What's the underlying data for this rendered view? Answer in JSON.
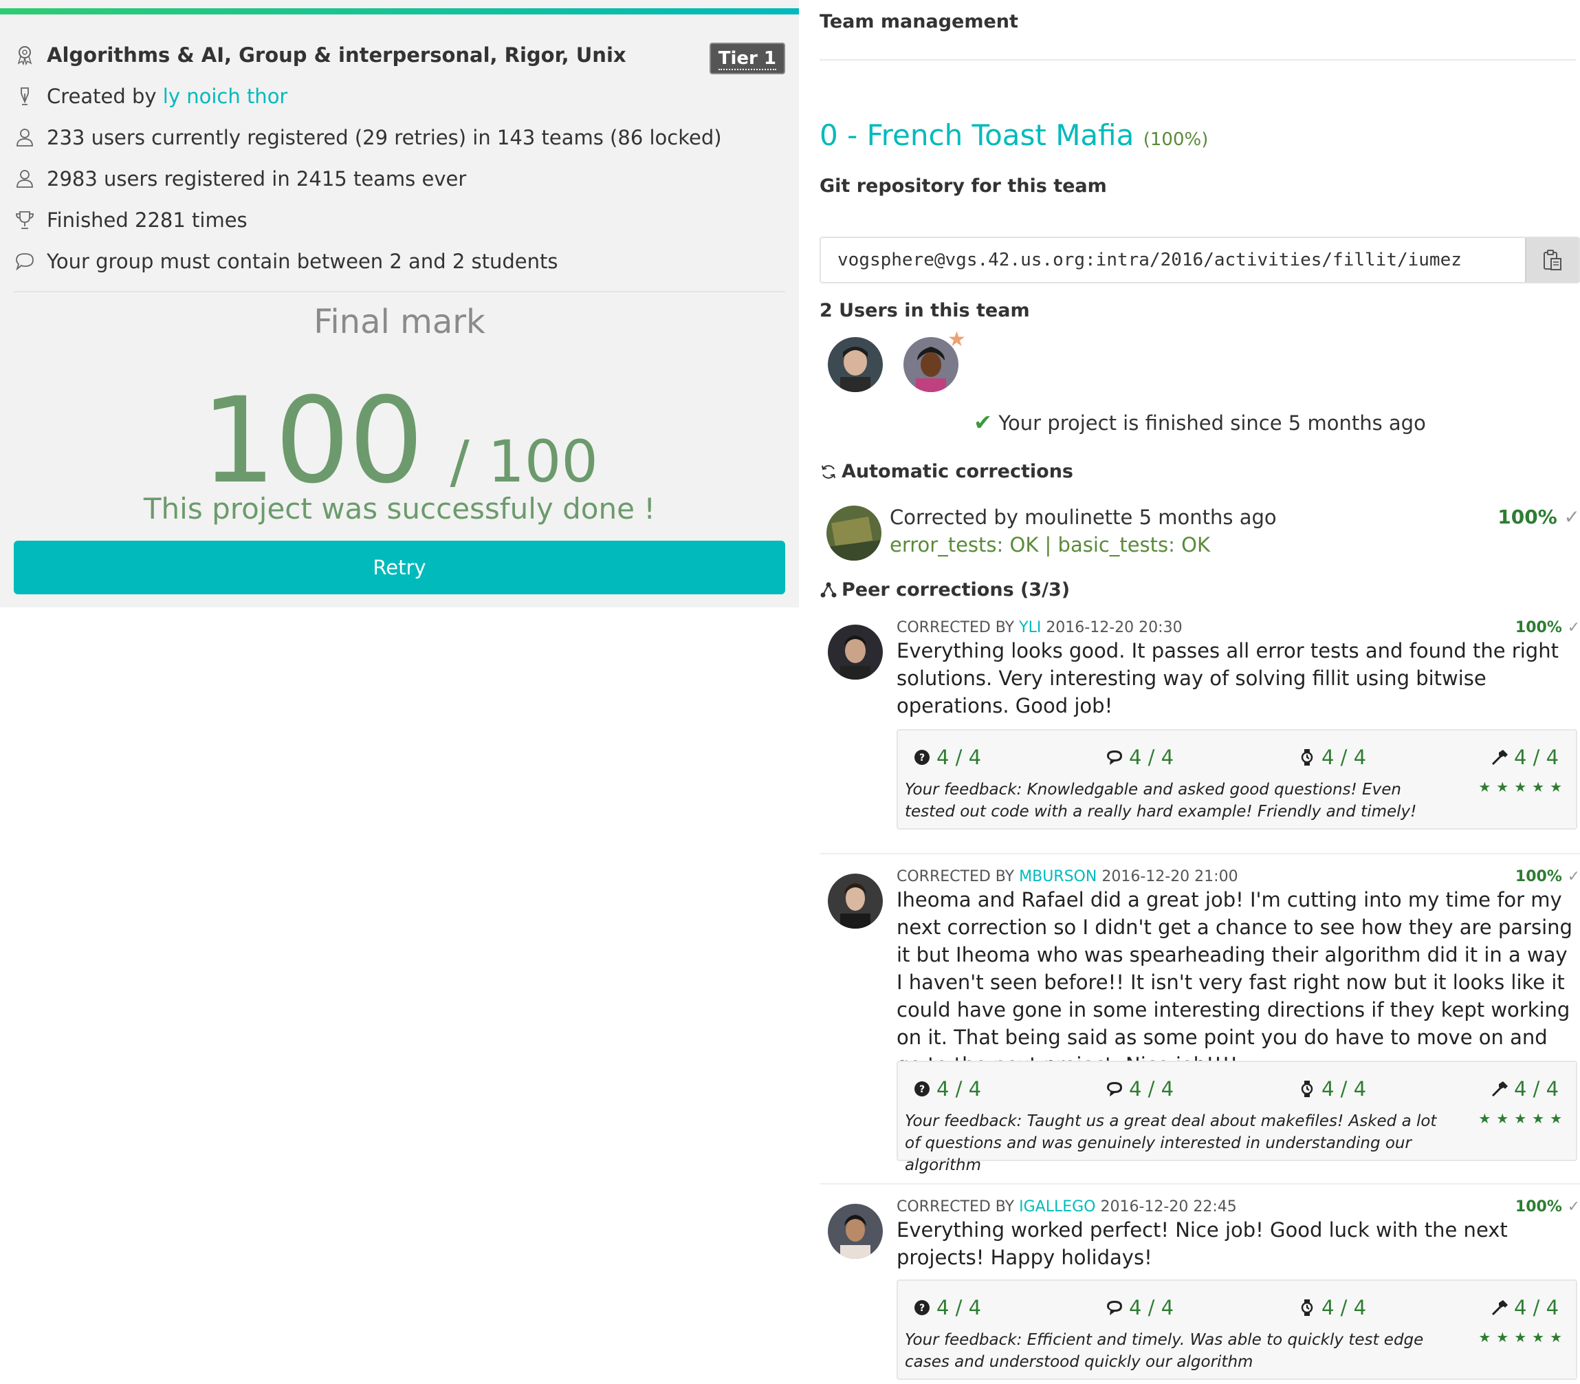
{
  "project": {
    "skills_title": "Algorithms & AI, Group & interpersonal, Rigor, Unix",
    "tier": "Tier 1",
    "created_by_prefix": "Created by",
    "created_by_link": "ly noich thor",
    "registered_line": "233 users currently registered (29 retries) in 143 teams (86 locked)",
    "ever_line": "2983 users registered in 2415 teams ever",
    "finished_line": "Finished 2281 times",
    "group_line": "Your group must contain between 2 and 2 students"
  },
  "final": {
    "title": "Final mark",
    "score": "100",
    "max": "/ 100",
    "message": "This project was successfuly done !",
    "retry_label": "Retry"
  },
  "team": {
    "header": "Team management",
    "name": "0 - French Toast Mafia",
    "percent": "(100%)",
    "git_header": "Git repository for this team",
    "git_url": "vogsphere@vgs.42.us.org:intra/2016/activities/fillit/iumez",
    "users_header": "2 Users in this team",
    "finished_msg": "Your project is finished since 5 months ago"
  },
  "automatic": {
    "header": "Automatic corrections",
    "line1": "Corrected by moulinette 5 months ago",
    "line2": "error_tests: OK | basic_tests: OK",
    "percent": "100%"
  },
  "peer": {
    "header": "Peer corrections (3/3)",
    "corrections": [
      {
        "prefix": "CORRECTED BY",
        "login": "YLI",
        "date": "2016-12-20 20:30",
        "percent": "100%",
        "comment": "Everything looks good. It passes all error tests and found the right solutions. Very interesting way of solving fillit using bitwise operations. Good job!",
        "scores": [
          "4 / 4",
          "4 / 4",
          "4 / 4",
          "4 / 4"
        ],
        "feedback": "Your feedback: Knowledgable and asked good questions! Even tested out code with a really hard example! Friendly and timely!",
        "stars": "★★★★★"
      },
      {
        "prefix": "CORRECTED BY",
        "login": "MBURSON",
        "date": "2016-12-20 21:00",
        "percent": "100%",
        "comment": "Iheoma and Rafael did a great job! I'm cutting into my time for my next correction so I didn't get a chance to see how they are parsing it but Iheoma who was spearheading their algorithm did it in a way I haven't seen before!! It isn't very fast right now but it looks like it could have gone in some interesting directions if they kept working on it. That being said as some point you do have to move on and go to the next project. Nice job!!!!",
        "scores": [
          "4 / 4",
          "4 / 4",
          "4 / 4",
          "4 / 4"
        ],
        "feedback": "Your feedback: Taught us a great deal about makefiles! Asked a lot of questions and was genuinely interested in understanding our algorithm",
        "stars": "★★★★★"
      },
      {
        "prefix": "CORRECTED BY",
        "login": "IGALLEGO",
        "date": "2016-12-20 22:45",
        "percent": "100%",
        "comment": "Everything worked perfect! Nice job! Good luck with the next projects! Happy holidays!",
        "scores": [
          "4 / 4",
          "4 / 4",
          "4 / 4",
          "4 / 4"
        ],
        "feedback": "Your feedback: Efficient and timely. Was able to quickly test edge cases and understood quickly our algorithm",
        "stars": "★★★★★"
      }
    ]
  },
  "colors": {
    "accent": "#00babc",
    "success": "#6c9a6c",
    "percent": "#2e7d32"
  }
}
